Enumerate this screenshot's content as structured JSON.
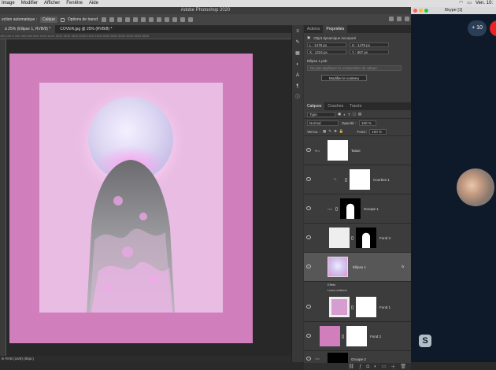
{
  "mac_menu": {
    "items": [
      "Image",
      "Modifier",
      "Afficher",
      "Fenêtre",
      "Aide"
    ],
    "time": "Ven. 10:"
  },
  "ps": {
    "title": "Adobe Photoshop 2020",
    "options": {
      "auto_select": "ection automatique :",
      "target": "Calque",
      "transform_options": "Options de transf."
    },
    "tabs": [
      {
        "label": "à 25% (Ellipse 1, RVB/8) *"
      },
      {
        "label": "COVER.jpg @ 25% (RVB/8) *"
      }
    ],
    "ruler_ticks": "150   100     0    200   400   600   800  1000  1200  1400  1600  1800  2000  2200  2400  2600  2800  3000  3200  3400  3600",
    "status": "le RVB (16/8) (8bpc)"
  },
  "properties": {
    "tabs": [
      "Actions",
      "Propriétés"
    ],
    "object_type": "Objet dynamique incorporé",
    "w": "L : 1478 px",
    "h": "H : 1478 px",
    "x": "X : 1224 px",
    "y": "Y : 867 px",
    "file": "Ellipse 1.psb",
    "comp_placeholder": "Ne pas appliquer la composition de calque",
    "edit_button": "Modifier le contenu"
  },
  "layers_panel": {
    "tabs": [
      "Calques",
      "Couches",
      "Tracés"
    ],
    "filter": "Type",
    "blend": "Normal",
    "opacity_label": "Opacité :",
    "opacity": "100 %",
    "lock_label": "Verrou. :",
    "fill_label": "Fond :",
    "fill": "100 %",
    "effects_label": "Effets",
    "effect_name": "Lueur externe",
    "layers": [
      {
        "name": "Tasse",
        "selected": false
      },
      {
        "name": "Courbes 1",
        "selected": false
      },
      {
        "name": "Groupe 1",
        "selected": false
      },
      {
        "name": "Fond 3",
        "selected": false
      },
      {
        "name": "Ellipse 1",
        "selected": true
      },
      {
        "name": "Fond 1",
        "selected": false
      },
      {
        "name": "Fond 2",
        "selected": false
      },
      {
        "name": "Groupe 2",
        "selected": false
      }
    ]
  },
  "skype": {
    "title": "Skype [1]",
    "add_count": "+ 10"
  }
}
